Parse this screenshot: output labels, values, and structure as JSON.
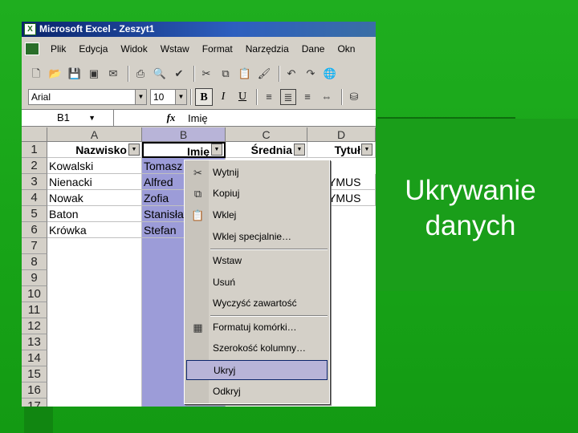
{
  "slide": {
    "title_line1": "Ukrywanie",
    "title_line2": "danych"
  },
  "window": {
    "app_icon": "X",
    "title": "Microsoft Excel - Zeszyt1"
  },
  "menu": [
    "Plik",
    "Edycja",
    "Widok",
    "Wstaw",
    "Format",
    "Narzędzia",
    "Dane",
    "Okn"
  ],
  "format_bar": {
    "font": "Arial",
    "size": "10",
    "bold": "B",
    "italic": "I",
    "underline": "U"
  },
  "formula_bar": {
    "name_box": "B1",
    "fx": "fx",
    "value": "Imię"
  },
  "columns": [
    "A",
    "B",
    "C",
    "D"
  ],
  "rows": [
    "1",
    "2",
    "3",
    "4",
    "5",
    "6",
    "7",
    "8",
    "9",
    "10",
    "11",
    "12",
    "13",
    "14",
    "15",
    "16",
    "17"
  ],
  "headers": {
    "a": "Nazwisko",
    "b": "Imię",
    "c": "Średnia",
    "d": "Tytuł"
  },
  "data": [
    {
      "a": "Kowalski",
      "b": "Tomasz",
      "d": ""
    },
    {
      "a": "Nienacki",
      "b": "Alfred",
      "d": "YMUS"
    },
    {
      "a": "Nowak",
      "b": "Zofia",
      "d": "YMUS"
    },
    {
      "a": "Baton",
      "b": "Stanisław",
      "d": ""
    },
    {
      "a": "Krówka",
      "b": "Stefan",
      "d": ""
    }
  ],
  "context_menu": [
    {
      "label": "Wytnij",
      "icon": "scissors-icon"
    },
    {
      "label": "Kopiuj",
      "icon": "copy-icon"
    },
    {
      "label": "Wklej",
      "icon": "paste-icon"
    },
    {
      "label": "Wklej specjalnie…"
    },
    {
      "label": "Wstaw"
    },
    {
      "label": "Usuń"
    },
    {
      "label": "Wyczyść zawartość"
    },
    {
      "label": "Formatuj komórki…",
      "icon": "format-cells-icon"
    },
    {
      "label": "Szerokość kolumny…"
    },
    {
      "label": "Ukryj",
      "highlighted": true
    },
    {
      "label": "Odkryj"
    }
  ]
}
